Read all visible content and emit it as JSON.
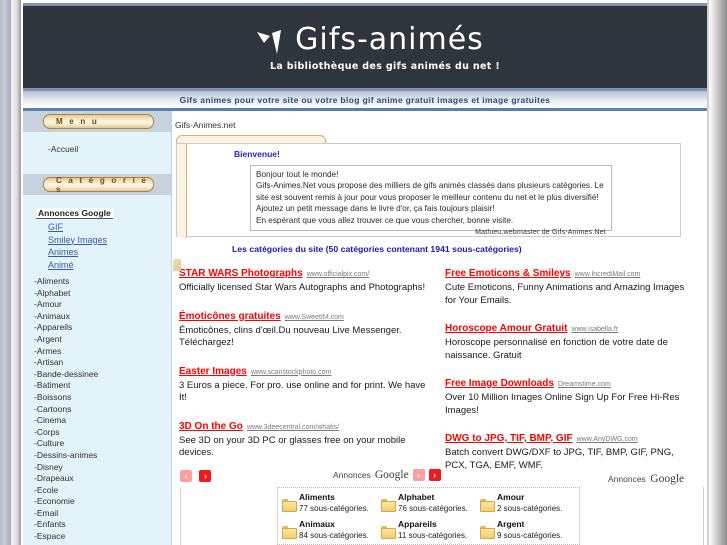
{
  "site": {
    "logo_title": "Gifs-animés",
    "logo_subtitle": "La bibliothèque des gifs animés du net !",
    "logo_icon": "butterfly-logo-icon",
    "tagline": "Gifs animes pour votre site ou votre blog gif anime gratuit images et image gratuites",
    "breadcrumb": "Gifs-Animes.net"
  },
  "sidebar": {
    "menu_tab_label": "M e n u",
    "menu_items": [
      {
        "label": "-Accueil"
      }
    ],
    "categories_tab_label": "C a t é g o r i e s",
    "ad_block": {
      "heading": "Annonces Google",
      "links": [
        "GIF",
        "Smiley Images",
        "Animes",
        "Animé"
      ]
    },
    "categories": [
      "-Aliments",
      "-Alphabet",
      "-Amour",
      "-Animaux",
      "-Appareils",
      "-Argent",
      "-Armes",
      "-Artisan",
      "-Bande-dessinee",
      "-Batiment",
      "-Boissons",
      "-Cartoons",
      "-Cinema",
      "-Corps",
      "-Culture",
      "-Dessins-animes",
      "-Disney",
      "-Drapeaux",
      "-Ecole",
      "-Economie",
      "-Email",
      "-Enfants",
      "-Espace"
    ]
  },
  "welcome": {
    "title": "Bienvenue!",
    "lines": [
      "Bonjour tout le monde!",
      "Gifs-Animes.Net vous propose des milliers de gifs animés classés dans plusieurs catégories. Le site est souvent remis à jour pour vous proposer le meilleur contenu du net et le plus diversifié!",
      "Ajoutez un petit message dans le livre d'or, ça fais toujours plaisir!",
      "En espérant que vous allez trouver ce que vous chercher, bonne visite."
    ],
    "signature": "Mathieu,webmaster de Gifs-Animes.Net",
    "categories_count_line": "Les catégories du site (50 catégories contenant 1941 sous-catégories)"
  },
  "ads": {
    "left_column": [
      {
        "title": "STAR WARS Photographs",
        "url": "www.officialpix.com/",
        "description": "Officially licensed Star Wars Autographs and Photographs!"
      },
      {
        "title": "Émoticônes gratuites",
        "url": "www.SweetIM.com",
        "description": "Émoticônes, clins d'œil.Du nouveau Live Messenger. Téléchargez!"
      },
      {
        "title": "Easter Images",
        "url": "www.scanstockphoto.com",
        "description": "3 Euros a piece. For pro. use online and for print. We have It!"
      },
      {
        "title": "3D On the Go",
        "url": "www.3deecentral.com/whatis/",
        "description": "See 3D on your 3D PC or glasses free on your mobile devices."
      }
    ],
    "right_column": [
      {
        "title": "Free Emoticons & Smileys",
        "url": "www.IncrediMail.com",
        "description": "Cute Emoticons, Funny Animations and Amazing Images for Your Emails."
      },
      {
        "title": "Horoscope Amour Gratuit",
        "url": "www.isabella.fr",
        "description": "Horoscope personnalisé en fonction de votre date de naissance. Gratuit"
      },
      {
        "title": "Free Image Downloads",
        "url": "Dreamstime.com",
        "description": "Over 10 Million Images Online Sign Up For Free Hi-Res Images!"
      },
      {
        "title": "DWG to JPG, TIF, BMP, GIF",
        "url": "www.AnyDWG.com",
        "description": "Batch convert DWG/DXF to JPG, TIF, BMP, GIF, PNG, PCX, TGA, EMF, WMF."
      }
    ]
  },
  "navbar": {
    "prev_label": "‹",
    "next_label": "›",
    "google_ads_prefix": "Annonces",
    "google_ads_word": "Google"
  },
  "folders": [
    {
      "name": "Aliments",
      "sub": "77 sous-catégories."
    },
    {
      "name": "Alphabet",
      "sub": "76 sous-catégories."
    },
    {
      "name": "Amour",
      "sub": "2 sous-catégories."
    },
    {
      "name": "Animaux",
      "sub": "84 sous-catégories."
    },
    {
      "name": "Appareils",
      "sub": "11 sous-catégories."
    },
    {
      "name": "Argent",
      "sub": "9 sous-catégories."
    }
  ],
  "colors": {
    "header_bg": "#2f353d",
    "accent_blue": "#5a7fb5",
    "panel_bg": "#e3f3fa",
    "tab_gold": "#e8c98e",
    "ad_red": "#ff0000",
    "link_blue": "#3b5aa6",
    "heading_blue": "#1a1aa8"
  }
}
